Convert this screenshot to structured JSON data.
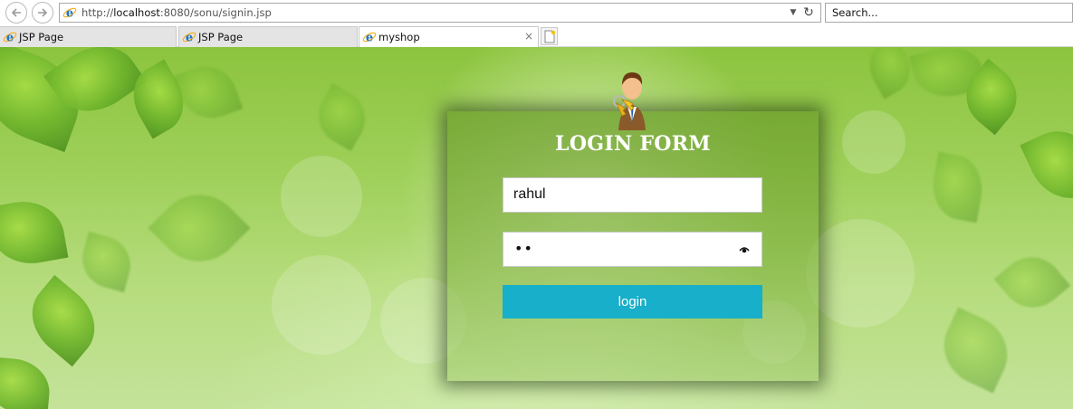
{
  "browser": {
    "address": {
      "prefix": "http://",
      "host": "localhost",
      "rest": ":8080/sonu/signin.jsp"
    },
    "search": {
      "placeholder": "Search..."
    },
    "tabs": [
      {
        "label": "JSP Page",
        "active": false
      },
      {
        "label": "JSP Page",
        "active": false
      },
      {
        "label": "myshop",
        "active": true
      }
    ],
    "close_glyph": "×"
  },
  "login": {
    "title": "LOGIN FORM",
    "username_value": "rahul",
    "password_masked": "••",
    "button_label": "login",
    "button_color": "#17afc9"
  },
  "icons": {
    "back": "back-arrow-icon",
    "forward": "forward-arrow-icon",
    "ie": "internet-explorer-icon",
    "refresh": "refresh-icon",
    "dropdown": "dropdown-arrow-icon",
    "new_tab": "new-tab-icon",
    "user": "user-with-keys-icon",
    "reveal": "password-reveal-icon"
  }
}
